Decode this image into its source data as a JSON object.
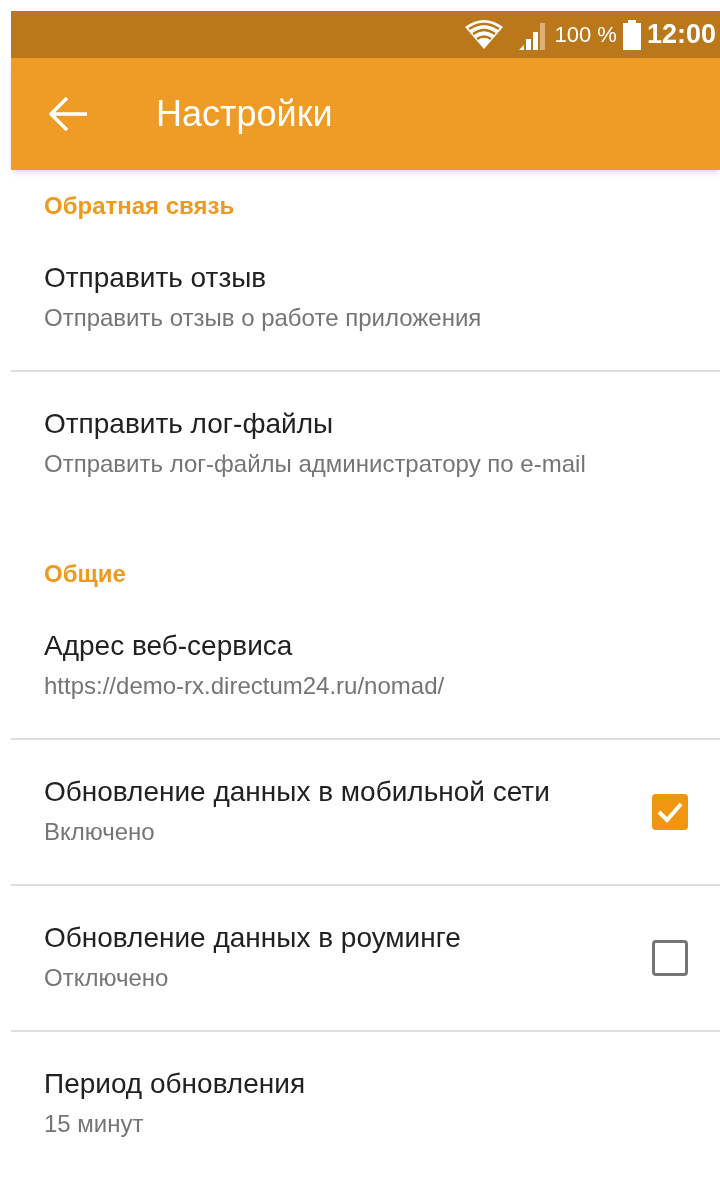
{
  "status_bar": {
    "battery": "100 %",
    "time": "12:00"
  },
  "toolbar": {
    "title": "Настройки"
  },
  "sections": [
    {
      "title": "Обратная связь",
      "items": [
        {
          "kind": "text",
          "title": "Отправить отзыв",
          "summary": "Отправить отзыв о работе приложения"
        },
        {
          "kind": "text",
          "title": "Отправить лог-файлы",
          "summary": "Отправить лог-файлы администратору по e-mail"
        }
      ]
    },
    {
      "title": "Общие",
      "items": [
        {
          "kind": "text",
          "title": "Адрес веб-сервиса",
          "summary": "https://demo-rx.directum24.ru/nomad/"
        },
        {
          "kind": "checkbox",
          "title": "Обновление данных в мобильной сети",
          "summary": "Включено",
          "checked": true
        },
        {
          "kind": "checkbox",
          "title": "Обновление данных в роуминге",
          "summary": "Отключено",
          "checked": false
        },
        {
          "kind": "text",
          "title": "Период обновления",
          "summary": "15 минут"
        }
      ]
    }
  ]
}
